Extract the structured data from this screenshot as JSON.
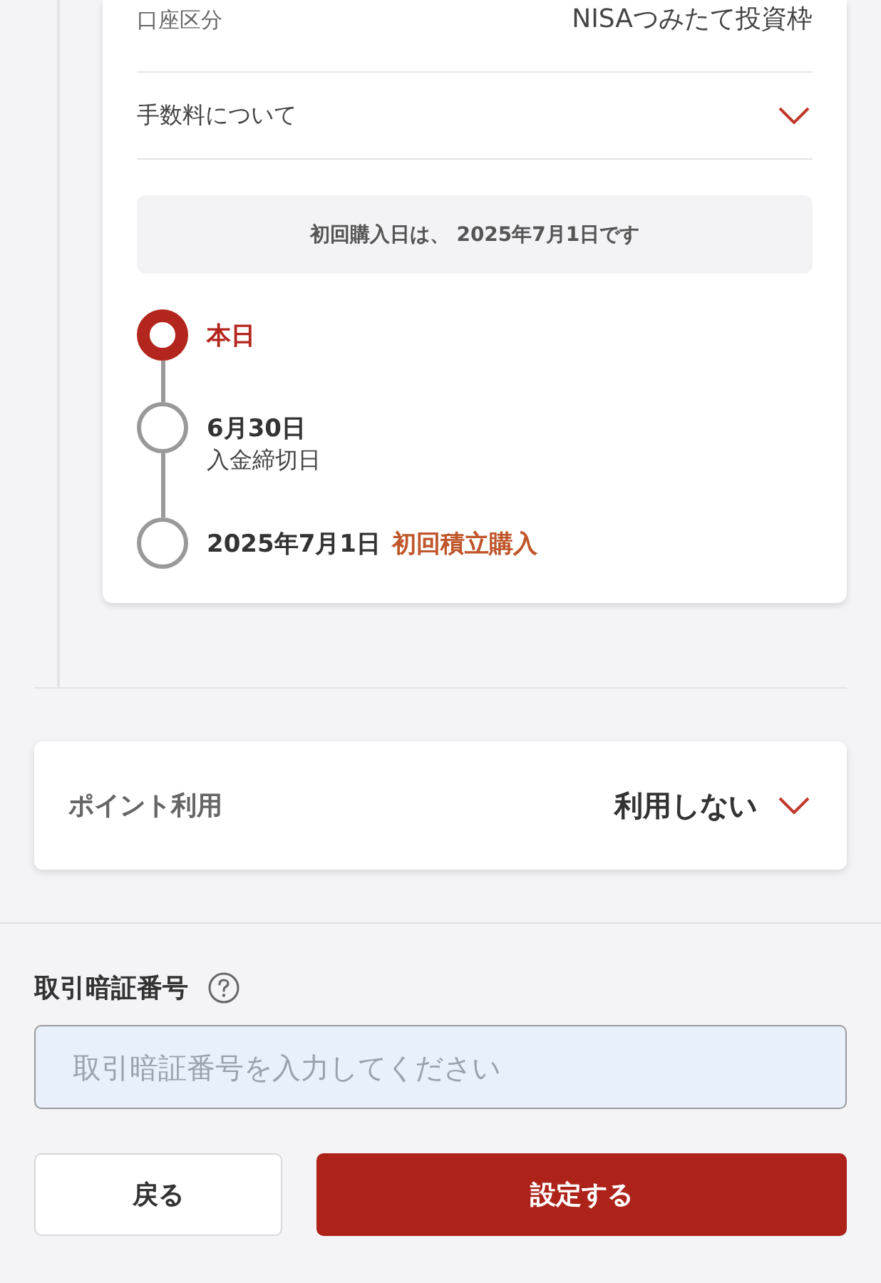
{
  "account_row": {
    "label": "口座区分",
    "value": "NISAつみたて投資枠"
  },
  "fee_row": {
    "label": "手数料について",
    "expanded": false
  },
  "first_purchase_notice": "初回購入日は、 2025年7月1日です",
  "timeline": [
    {
      "date": "本日",
      "current": true
    },
    {
      "date": "6月30日",
      "note": "入金締切日",
      "current": false
    },
    {
      "date": "2025年7月1日",
      "tag": "初回積立購入",
      "current": false
    }
  ],
  "point_usage": {
    "label": "ポイント利用",
    "value": "利用しない",
    "expanded": false
  },
  "pin": {
    "label": "取引暗証番号",
    "placeholder": "取引暗証番号を入力してください"
  },
  "buttons": [
    {
      "label": "戻る",
      "kind": "secondary"
    },
    {
      "label": "設定する",
      "kind": "primary"
    }
  ]
}
